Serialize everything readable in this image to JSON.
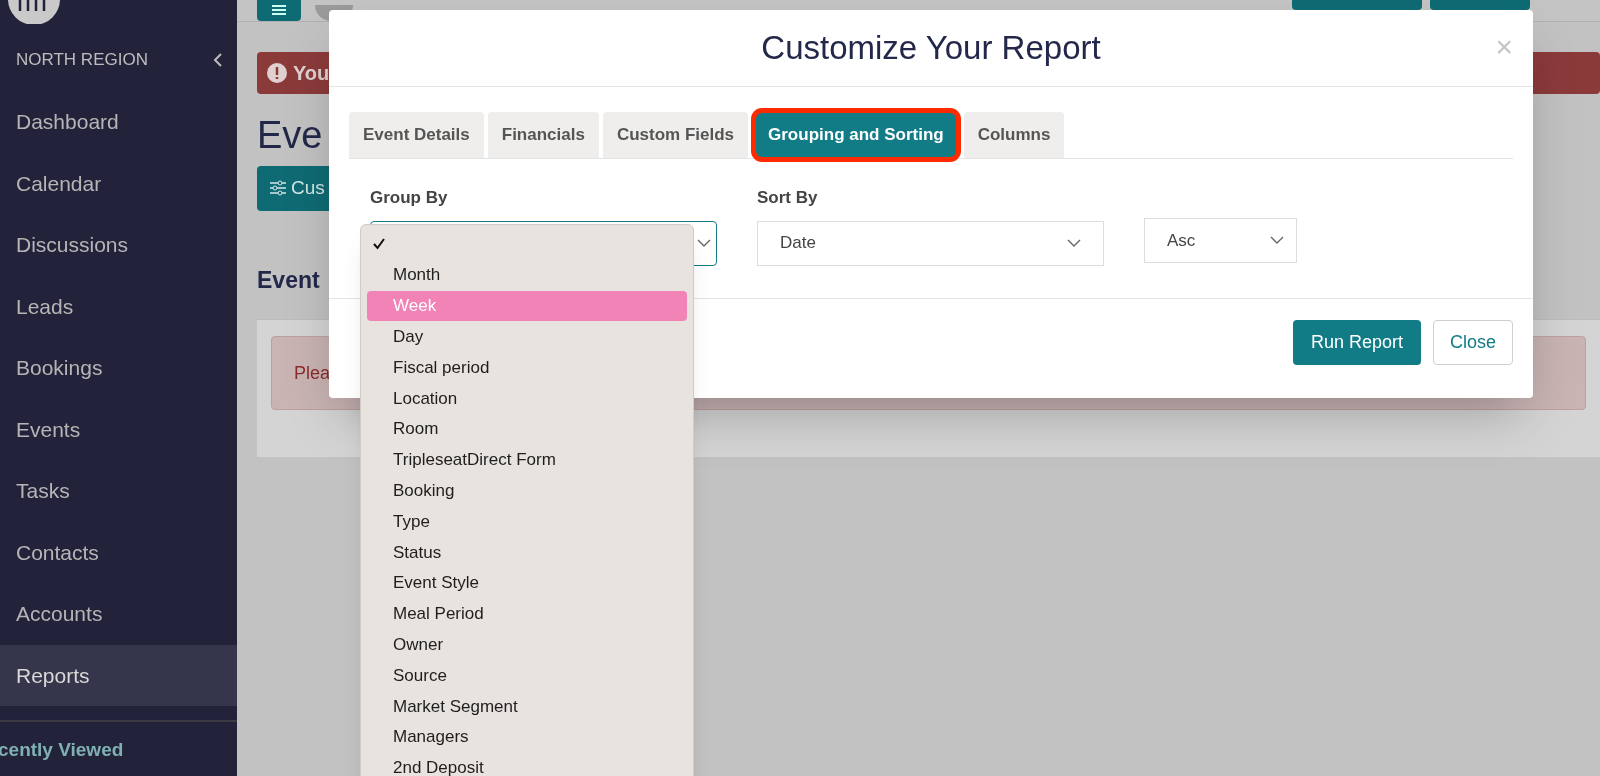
{
  "sidebar": {
    "region": "NORTH REGION",
    "items": [
      {
        "label": "Dashboard",
        "selected": false
      },
      {
        "label": "Calendar",
        "selected": false
      },
      {
        "label": "Discussions",
        "selected": false
      },
      {
        "label": "Leads",
        "selected": false
      },
      {
        "label": "Bookings",
        "selected": false
      },
      {
        "label": "Events",
        "selected": false
      },
      {
        "label": "Tasks",
        "selected": false
      },
      {
        "label": "Contacts",
        "selected": false
      },
      {
        "label": "Accounts",
        "selected": false
      },
      {
        "label": "Reports",
        "selected": true
      }
    ],
    "recently_viewed": "cently Viewed"
  },
  "main": {
    "alert": "You",
    "heading": "Eve",
    "customize_button": "Cus",
    "section_title": "Event",
    "notice": "Plea"
  },
  "modal": {
    "title": "Customize Your Report",
    "close": "×",
    "tabs": [
      {
        "label": "Event Details",
        "selected": false
      },
      {
        "label": "Financials",
        "selected": false
      },
      {
        "label": "Custom Fields",
        "selected": false
      },
      {
        "label": "Grouping and Sorting",
        "selected": true
      },
      {
        "label": "Columns",
        "selected": false
      }
    ],
    "group_by": {
      "label": "Group By",
      "options": [
        {
          "checked": true,
          "selected": false
        },
        {
          "label": "Month",
          "checked": false,
          "selected": false
        },
        {
          "label": "Week",
          "checked": false,
          "selected": true
        },
        {
          "label": "Day",
          "checked": false,
          "selected": false
        },
        {
          "label": "Fiscal period",
          "checked": false,
          "selected": false
        },
        {
          "label": "Location",
          "checked": false,
          "selected": false
        },
        {
          "label": "Room",
          "checked": false,
          "selected": false
        },
        {
          "label": "TripleseatDirect Form",
          "checked": false,
          "selected": false
        },
        {
          "label": "Booking",
          "checked": false,
          "selected": false
        },
        {
          "label": "Type",
          "checked": false,
          "selected": false
        },
        {
          "label": "Status",
          "checked": false,
          "selected": false
        },
        {
          "label": "Event Style",
          "checked": false,
          "selected": false
        },
        {
          "label": "Meal Period",
          "checked": false,
          "selected": false
        },
        {
          "label": "Owner",
          "checked": false,
          "selected": false
        },
        {
          "label": "Source",
          "checked": false,
          "selected": false
        },
        {
          "label": "Market Segment",
          "checked": false,
          "selected": false
        },
        {
          "label": "Managers",
          "checked": false,
          "selected": false
        },
        {
          "label": "2nd Deposit",
          "checked": false,
          "selected": false
        }
      ]
    },
    "sort_by": {
      "label": "Sort By",
      "value": "Date"
    },
    "direction": {
      "value": "Asc"
    },
    "buttons": {
      "run": "Run Report",
      "close": "Close"
    }
  }
}
